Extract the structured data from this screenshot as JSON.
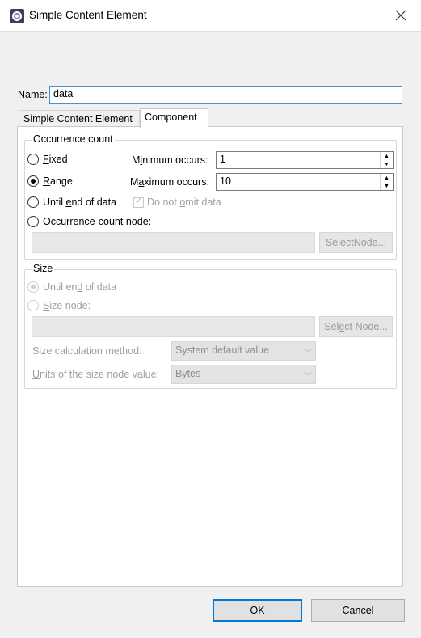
{
  "window": {
    "title": "Simple Content Element",
    "close_glyph": "✕"
  },
  "name": {
    "label_pre": "Na",
    "label_mnemonic": "m",
    "label_post": "e:",
    "value": "data"
  },
  "tabs": [
    {
      "label": "Simple Content Element",
      "active": false
    },
    {
      "label": "Component",
      "active": true
    }
  ],
  "occurrence": {
    "group_label": "Occurrence count",
    "fixed": {
      "pre": "",
      "m": "F",
      "post": "ixed",
      "checked": false
    },
    "range": {
      "pre": "",
      "m": "R",
      "post": "ange",
      "checked": true
    },
    "until_end": {
      "pre": "Until ",
      "m": "e",
      "post": "nd of data",
      "checked": false
    },
    "count_node": {
      "pre": "Occurrence-",
      "m": "c",
      "post": "ount node:",
      "checked": false
    },
    "min_label": {
      "pre": "M",
      "m": "i",
      "post": "nimum occurs:"
    },
    "min_value": "1",
    "max_label": {
      "pre": "M",
      "m": "a",
      "post": "ximum occurs:"
    },
    "max_value": "10",
    "do_not_omit": {
      "pre": "Do not ",
      "m": "o",
      "post": "mit data",
      "checked": true
    },
    "select_node": {
      "pre": "Select ",
      "m": "N",
      "post": "ode..."
    }
  },
  "size": {
    "group_label": "Size",
    "until_end": {
      "pre": "Until en",
      "m": "d",
      "post": " of data",
      "checked": true
    },
    "size_node": {
      "pre": "",
      "m": "S",
      "post": "ize node:",
      "checked": false
    },
    "select_node": {
      "pre": "Sel",
      "m": "e",
      "post": "ct Node..."
    },
    "calc_method_label": "Size calculation method:",
    "calc_method_value": "System default value",
    "units_label": {
      "pre": "",
      "m": "U",
      "post": "nits of the size node value:"
    },
    "units_value": "Bytes"
  },
  "buttons": {
    "ok": "OK",
    "cancel": "Cancel"
  }
}
